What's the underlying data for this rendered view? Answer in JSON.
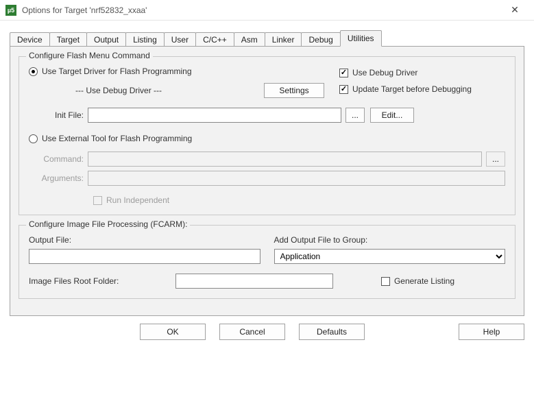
{
  "window": {
    "title": "Options for Target 'nrf52832_xxaa'",
    "icon_text": "µ5"
  },
  "tabs": [
    "Device",
    "Target",
    "Output",
    "Listing",
    "User",
    "C/C++",
    "Asm",
    "Linker",
    "Debug",
    "Utilities"
  ],
  "active_tab": "Utilities",
  "flash_group": {
    "title": "Configure Flash Menu Command",
    "use_target_label": "Use Target Driver for Flash Programming",
    "driver_note": "--- Use Debug Driver ---",
    "settings_btn": "Settings",
    "use_debug_driver": "Use Debug Driver",
    "update_before_debug": "Update Target before Debugging",
    "init_file_label": "Init File:",
    "init_file_value": "",
    "browse": "...",
    "edit_btn": "Edit...",
    "use_external_label": "Use External Tool for Flash Programming",
    "command_label": "Command:",
    "command_value": "",
    "arguments_label": "Arguments:",
    "arguments_value": "",
    "run_independent": "Run Independent"
  },
  "fcarm_group": {
    "title": "Configure Image File Processing (FCARM):",
    "output_file_label": "Output File:",
    "output_file_value": "",
    "add_to_group_label": "Add Output File  to Group:",
    "add_to_group_value": "Application",
    "root_folder_label": "Image Files Root Folder:",
    "root_folder_value": "",
    "generate_listing": "Generate Listing"
  },
  "footer": {
    "ok": "OK",
    "cancel": "Cancel",
    "defaults": "Defaults",
    "help": "Help"
  }
}
